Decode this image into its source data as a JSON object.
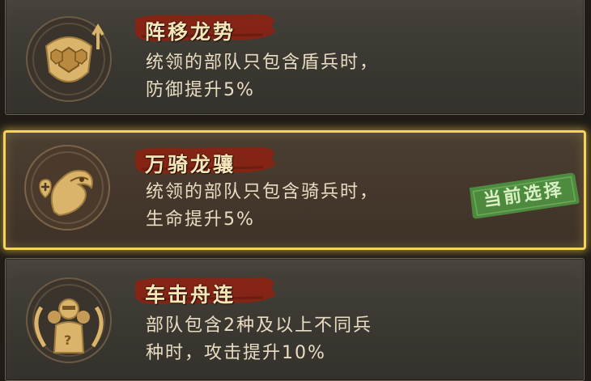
{
  "options": [
    {
      "title": "阵移龙势",
      "desc_line1": "统领的部队只包含盾兵时，",
      "desc_line2": "防御提升5%",
      "icon": "shield-turtle-icon"
    },
    {
      "title": "万骑龙骧",
      "desc_line1": "统领的部队只包含骑兵时，",
      "desc_line2": "生命提升5%",
      "icon": "dragon-heart-icon",
      "badge": "当前选择"
    },
    {
      "title": "车击舟连",
      "desc_line1": "部队包含2种及以上不同兵",
      "desc_line2": "种时，攻击提升10%",
      "icon": "soldiers-icon"
    }
  ],
  "colors": {
    "highlight": "#f4d45a",
    "stamp_green": "#4e8f3f",
    "title_brush": "#8a2314",
    "gold": "#e2c277"
  }
}
